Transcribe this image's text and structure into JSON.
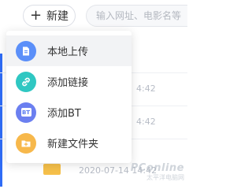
{
  "toolbar": {
    "new_label": "新建",
    "url_placeholder": "输入网址、电影名等"
  },
  "menu": {
    "items": [
      {
        "label": "本地上传",
        "icon": "upload-file-icon",
        "color": "#5b8ff9"
      },
      {
        "label": "添加链接",
        "icon": "link-icon",
        "color": "#2fc7c2"
      },
      {
        "label": "添加BT",
        "icon": "bt-torrent-icon",
        "color": "#6b7ff0",
        "icon_text": "BT"
      },
      {
        "label": "新建文件夹",
        "icon": "new-folder-icon",
        "color": "#f7b84b"
      }
    ]
  },
  "background_list": {
    "time_1": "4:42",
    "time_2": "4:42",
    "date_3": "2020-07-14 14:42"
  },
  "watermark": {
    "main": "PConline",
    "sub": "太平洋电脑网"
  },
  "colors": {
    "accent": "#2f6cf6",
    "menu_hover": "#f2f3f5"
  }
}
